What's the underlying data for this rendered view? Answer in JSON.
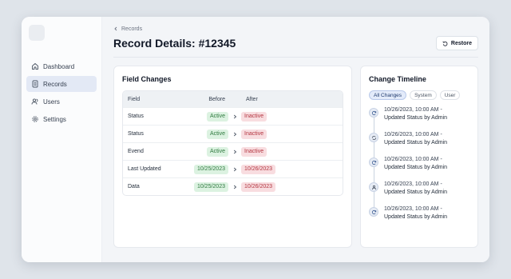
{
  "sidebar": {
    "items": [
      {
        "label": "Dashboard",
        "icon": "home-icon"
      },
      {
        "label": "Records",
        "icon": "document-icon",
        "active": true
      },
      {
        "label": "Users",
        "icon": "users-icon"
      },
      {
        "label": "Settings",
        "icon": "gear-icon"
      }
    ]
  },
  "header": {
    "breadcrumb": "Records",
    "title": "Record Details: #12345",
    "restore_label": "Restore"
  },
  "field_changes": {
    "title": "Field Changes",
    "columns": [
      "Field",
      "Before",
      "After"
    ],
    "rows": [
      {
        "field": "Status",
        "before": "Active",
        "after": "Inactive"
      },
      {
        "field": "Status",
        "before": "Active",
        "after": "Inactive"
      },
      {
        "field": "Evend",
        "before": "Active",
        "after": "Inactive"
      },
      {
        "field": "Last Updated",
        "before": "10/25/2023",
        "after": "10/26/2023"
      },
      {
        "field": "Data",
        "before": "10/25/2023",
        "after": "10/26/2023"
      }
    ]
  },
  "timeline": {
    "title": "Change Timeline",
    "filters": [
      "All Changes",
      "System",
      "User"
    ],
    "active_filter": "All Changes",
    "entries": [
      {
        "time": "10/26/2023, 10:00 AM -",
        "action": "Updated Status by Admin",
        "icon": "refresh-icon"
      },
      {
        "time": "10/26/2023, 10:00 AM -",
        "action": "Updated Status by Admin",
        "icon": "sync-icon"
      },
      {
        "time": "10/26/2023, 10:00 AM -",
        "action": "Updated Status by Admin",
        "icon": "refresh-icon"
      },
      {
        "time": "10/26/2023, 10:00 AM -",
        "action": "Updated Status by Admin",
        "icon": "user-icon"
      },
      {
        "time": "10/26/2023, 10:00 AM -",
        "action": "Updated Status by Admin",
        "icon": "refresh-icon"
      }
    ]
  },
  "colors": {
    "accent": "#e3e9f5",
    "before_pill": "#dcf2e1",
    "after_pill": "#f8dde0"
  }
}
